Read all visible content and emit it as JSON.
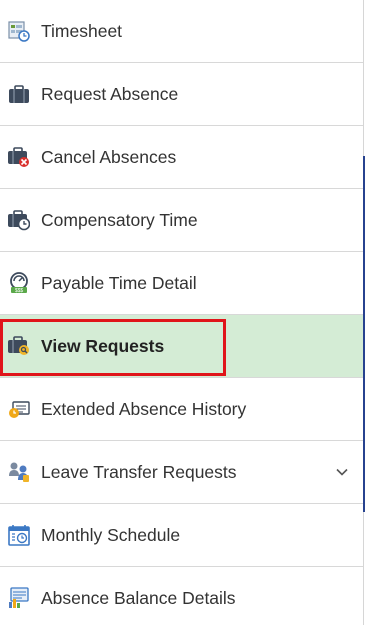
{
  "menu": {
    "items": [
      {
        "label": "Timesheet",
        "icon": "timesheet-icon"
      },
      {
        "label": "Request Absence",
        "icon": "briefcase-icon"
      },
      {
        "label": "Cancel Absences",
        "icon": "briefcase-cancel-icon"
      },
      {
        "label": "Compensatory Time",
        "icon": "briefcase-clock-icon"
      },
      {
        "label": "Payable Time Detail",
        "icon": "payable-time-icon"
      },
      {
        "label": "View Requests",
        "icon": "briefcase-view-icon",
        "selected": true
      },
      {
        "label": "Extended Absence History",
        "icon": "absence-history-icon"
      },
      {
        "label": "Leave Transfer Requests",
        "icon": "leave-transfer-icon",
        "expandable": true
      },
      {
        "label": "Monthly Schedule",
        "icon": "calendar-icon"
      },
      {
        "label": "Absence Balance Details",
        "icon": "balance-chart-icon"
      }
    ]
  },
  "colors": {
    "selected_bg": "#d4ecd5",
    "highlight_border": "#e0141a",
    "accent_line": "#27428f"
  }
}
